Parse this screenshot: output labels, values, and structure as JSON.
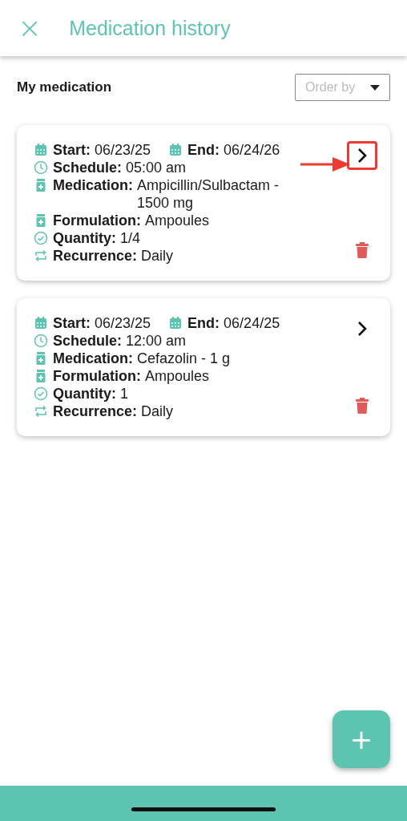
{
  "header": {
    "close_icon": "×",
    "title": "Medication history"
  },
  "section": {
    "title": "My medication",
    "order_by": {
      "placeholder": "Order by"
    }
  },
  "cards": [
    {
      "highlighted": true,
      "dates": [
        {
          "label": "Start:",
          "value": "06/23/25"
        },
        {
          "label": "End:",
          "value": "06/24/26"
        }
      ],
      "rows": [
        {
          "kind": "clock",
          "label": "Schedule:",
          "value": "05:00 am"
        },
        {
          "kind": "bottle",
          "label": "Medication:",
          "value": "Ampicillin/Sulbactam - 1500 mg"
        },
        {
          "kind": "bottle",
          "label": "Formulation:",
          "value": "Ampoules"
        },
        {
          "kind": "check",
          "label": "Quantity:",
          "value": "1/4"
        },
        {
          "kind": "repeat",
          "label": "Recurrence:",
          "value": "Daily"
        }
      ]
    },
    {
      "highlighted": false,
      "dates": [
        {
          "label": "Start:",
          "value": "06/23/25"
        },
        {
          "label": "End:",
          "value": "06/24/25"
        }
      ],
      "rows": [
        {
          "kind": "clock",
          "label": "Schedule:",
          "value": "12:00 am"
        },
        {
          "kind": "bottle",
          "label": "Medication:",
          "value": "Cefazolin - 1 g"
        },
        {
          "kind": "bottle",
          "label": "Formulation:",
          "value": "Ampoules"
        },
        {
          "kind": "check",
          "label": "Quantity:",
          "value": "1"
        },
        {
          "kind": "repeat",
          "label": "Recurrence:",
          "value": "Daily"
        }
      ]
    }
  ],
  "fab": {
    "label": "+"
  }
}
